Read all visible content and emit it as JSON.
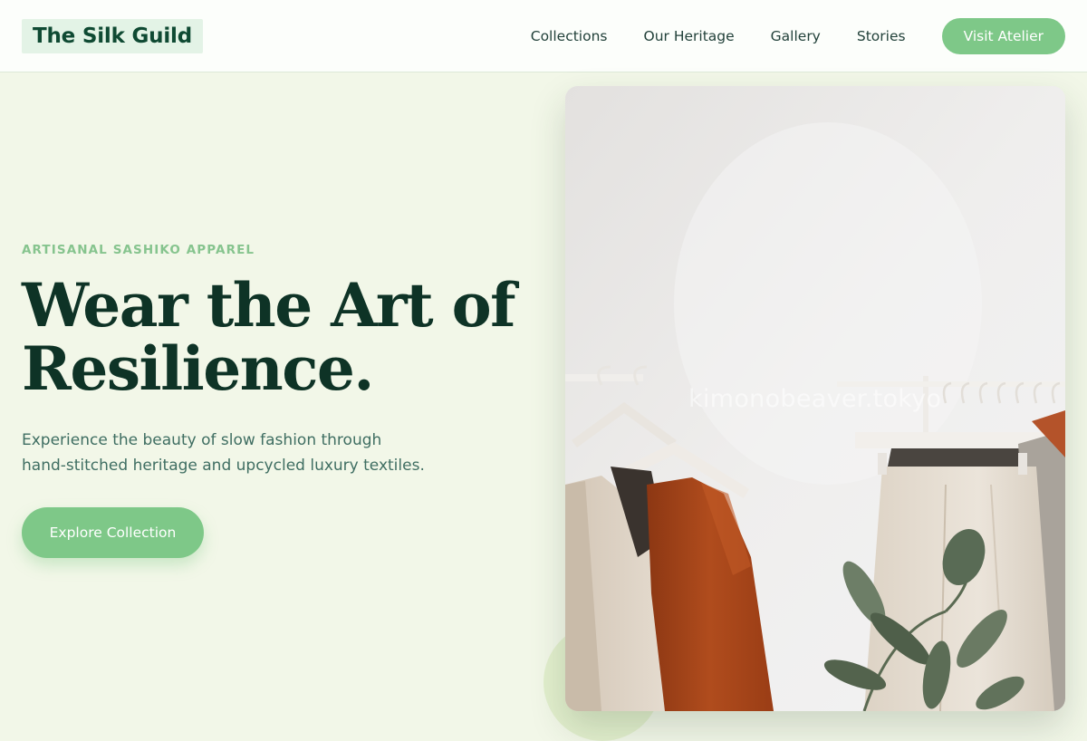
{
  "header": {
    "brand": "The Silk Guild",
    "nav": [
      "Collections",
      "Our Heritage",
      "Gallery",
      "Stories"
    ],
    "cta": "Visit Atelier"
  },
  "hero": {
    "eyebrow": "ARTISANAL SASHIKO APPAREL",
    "headline_line1": "Wear the Art of",
    "headline_line2": "Resilience.",
    "subtext_line1": "Experience the beauty of slow fashion through",
    "subtext_line2": "hand-stitched heritage and upcycled luxury textiles.",
    "button": "Explore Collection"
  },
  "image": {
    "watermark": "kimonobeaver.tokyo"
  },
  "colors": {
    "accent": "#7ec888",
    "dark_green": "#0e3326",
    "background": "#f2f7e8"
  }
}
